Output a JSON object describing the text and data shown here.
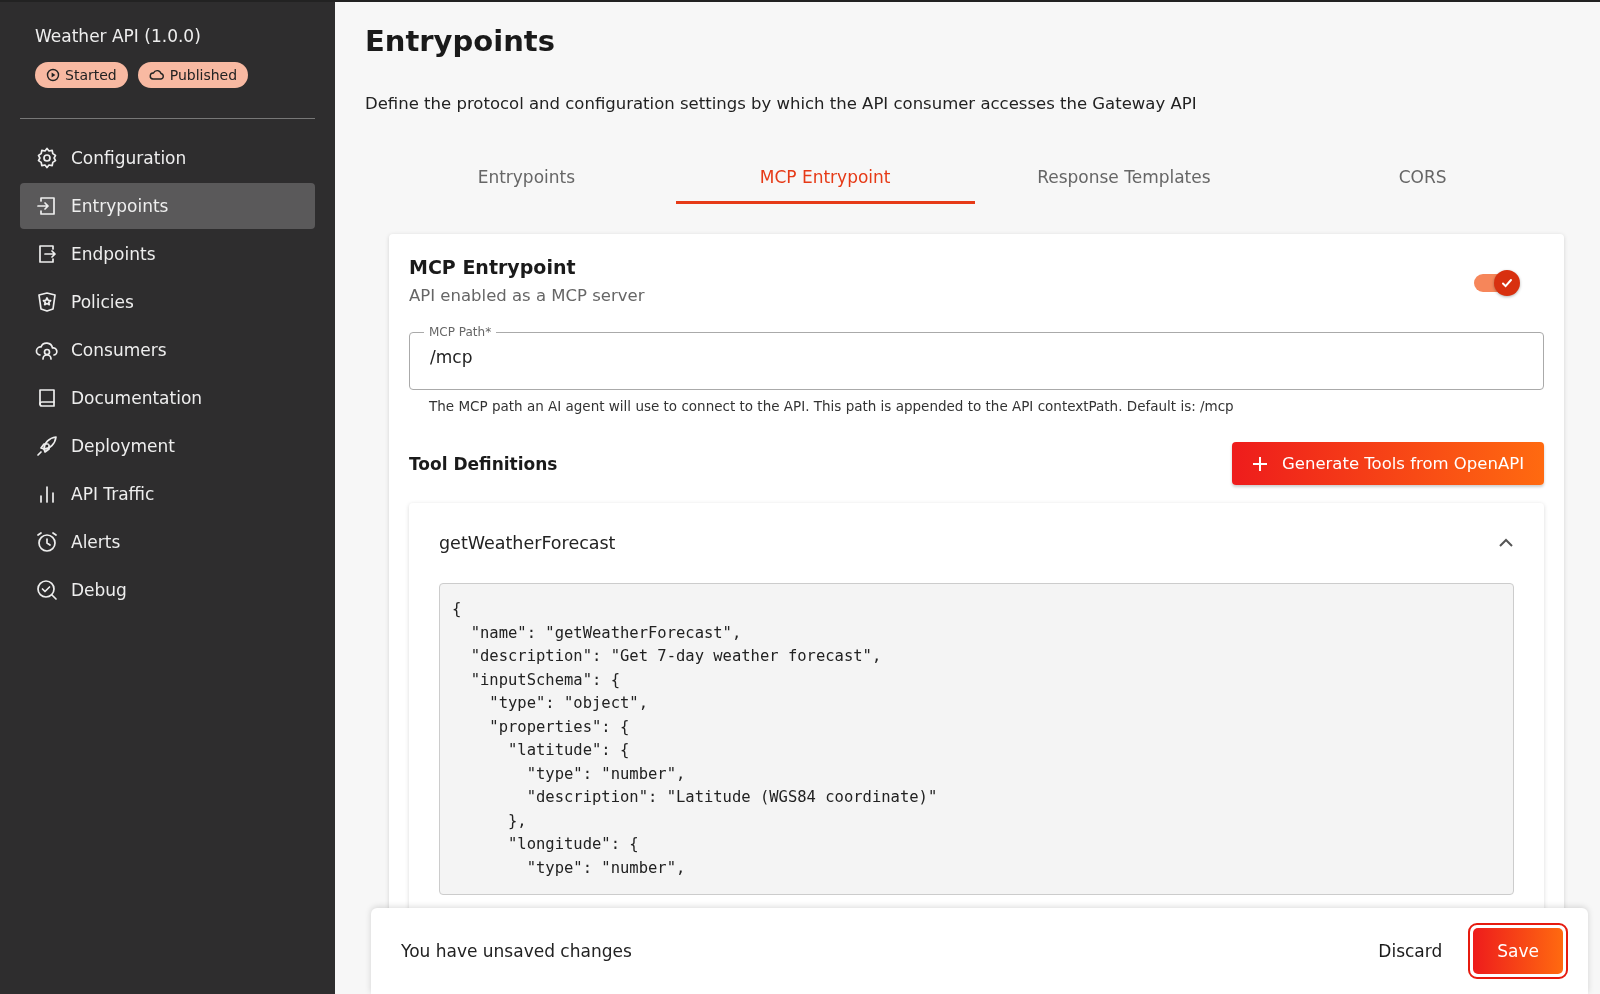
{
  "sidebar": {
    "api_title": "Weather API (1.0.0)",
    "badges": [
      {
        "kind": "started",
        "label": "Started"
      },
      {
        "kind": "published",
        "label": "Published"
      }
    ],
    "items": [
      {
        "kind": "gear",
        "label": "Configuration",
        "selected": false
      },
      {
        "kind": "enter",
        "label": "Entrypoints",
        "selected": true
      },
      {
        "kind": "exit",
        "label": "Endpoints",
        "selected": false
      },
      {
        "kind": "shield",
        "label": "Policies",
        "selected": false
      },
      {
        "kind": "users",
        "label": "Consumers",
        "selected": false
      },
      {
        "kind": "book",
        "label": "Documentation",
        "selected": false
      },
      {
        "kind": "rocket",
        "label": "Deployment",
        "selected": false
      },
      {
        "kind": "bars",
        "label": "API Traffic",
        "selected": false
      },
      {
        "kind": "alarm",
        "label": "Alerts",
        "selected": false
      },
      {
        "kind": "debug",
        "label": "Debug",
        "selected": false
      }
    ]
  },
  "page": {
    "title": "Entrypoints",
    "description": "Define the protocol and configuration settings by which the API consumer accesses the Gateway API"
  },
  "tabs": [
    {
      "label": "Entrypoints",
      "selected": false
    },
    {
      "label": "MCP Entrypoint",
      "selected": true
    },
    {
      "label": "Response Templates",
      "selected": false
    },
    {
      "label": "CORS",
      "selected": false
    }
  ],
  "card": {
    "title": "MCP Entrypoint",
    "subtitle": "API enabled as a MCP server",
    "enabled": true,
    "path_field": {
      "label": "MCP Path*",
      "value": "/mcp",
      "hint": "The MCP path an AI agent will use to connect to the API. This path is appended to the API contextPath. Default is: /mcp"
    },
    "tools_heading": "Tool Definitions",
    "generate_button": "Generate Tools from OpenAPI",
    "tools": [
      {
        "name": "getWeatherForecast",
        "expanded": true,
        "code": [
          "{",
          "  \"name\": \"getWeatherForecast\",",
          "  \"description\": \"Get 7-day weather forecast\",",
          "  \"inputSchema\": {",
          "    \"type\": \"object\",",
          "    \"properties\": {",
          "      \"latitude\": {",
          "        \"type\": \"number\",",
          "        \"description\": \"Latitude (WGS84 coordinate)\"",
          "      },",
          "      \"longitude\": {",
          "        \"type\": \"number\","
        ]
      }
    ]
  },
  "unsaved_bar": {
    "message": "You have unsaved changes",
    "discard": "Discard",
    "save": "Save"
  }
}
